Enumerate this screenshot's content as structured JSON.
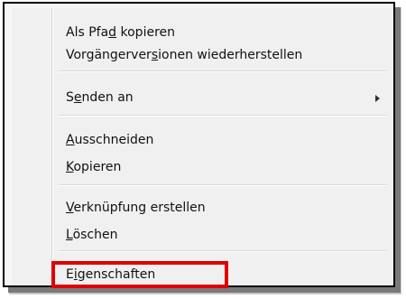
{
  "menu": {
    "items": [
      {
        "before": "Als Pfa",
        "mnemonic": "d",
        "after": " kopieren"
      },
      {
        "before": "Vorgängerver",
        "mnemonic": "s",
        "after": "ionen wiederherstellen"
      },
      {
        "before": "S",
        "mnemonic": "e",
        "after": "nden an",
        "has_submenu": true
      },
      {
        "before": "",
        "mnemonic": "A",
        "after": "usschneiden"
      },
      {
        "before": "",
        "mnemonic": "K",
        "after": "opieren"
      },
      {
        "before": "",
        "mnemonic": "V",
        "after": "erknüpfung erstellen"
      },
      {
        "before": "",
        "mnemonic": "L",
        "after": "öschen"
      },
      {
        "before": "E",
        "mnemonic": "i",
        "after": "genschaften"
      }
    ]
  },
  "submenu_arrow_icon": "chevron-right-icon",
  "highlight_color": "#e00000"
}
